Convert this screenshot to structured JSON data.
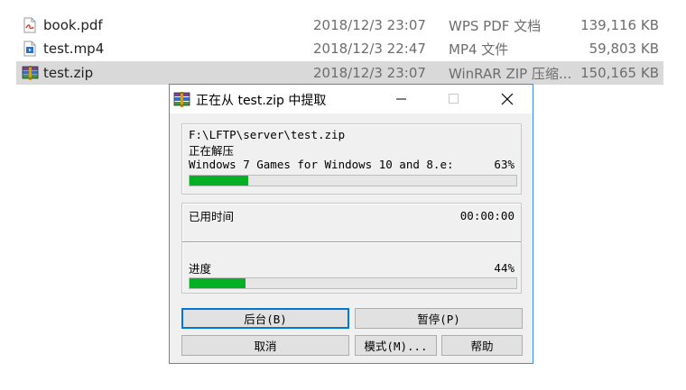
{
  "explorer": {
    "files": [
      {
        "name": "book.pdf",
        "date": "2018/12/3 23:07",
        "type": "WPS PDF 文档",
        "size": "139,116 KB",
        "icon": "pdf-file-icon",
        "selected": false
      },
      {
        "name": "test.mp4",
        "date": "2018/12/3 22:47",
        "type": "MP4 文件",
        "size": "59,803 KB",
        "icon": "video-file-icon",
        "selected": false
      },
      {
        "name": "test.zip",
        "date": "2018/12/3 23:07",
        "type": "WinRAR ZIP 压缩...",
        "size": "150,165 KB",
        "icon": "winrar-archive-icon",
        "selected": true
      }
    ]
  },
  "dialog": {
    "title": "正在从 test.zip 中提取",
    "titlebar_icons": [
      "minimize-icon",
      "maximize-icon",
      "close-icon"
    ],
    "archive_path": "F:\\LFTP\\server\\test.zip",
    "operation": "正在解压",
    "current_file": "Windows 7 Games for Windows 10 and 8.e:",
    "file_percent_label": "63%",
    "file_progress": 0.18,
    "elapsed_label": "已用时间",
    "elapsed_value": "00:00:00",
    "progress_label": "进度",
    "total_percent_label": "44%",
    "total_progress": 0.17,
    "accent_color": "#06b025",
    "buttons": {
      "background": "后台(B)",
      "pause": "暂停(P)",
      "cancel": "取消",
      "mode": "模式(M)...",
      "help": "帮助"
    }
  }
}
